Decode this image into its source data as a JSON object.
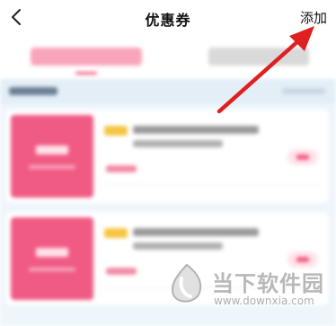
{
  "header": {
    "back_icon": "chevron-left-icon",
    "title": "优惠券",
    "add_label": "添加"
  },
  "annotation": {
    "arrow_color": "#e02020"
  },
  "content": {
    "blurred": true,
    "accent_color": "#f05b84",
    "tabs_count": 2,
    "cards_count": 2
  },
  "watermark": {
    "name": "当下软件园",
    "url": "www.downxia.com"
  }
}
